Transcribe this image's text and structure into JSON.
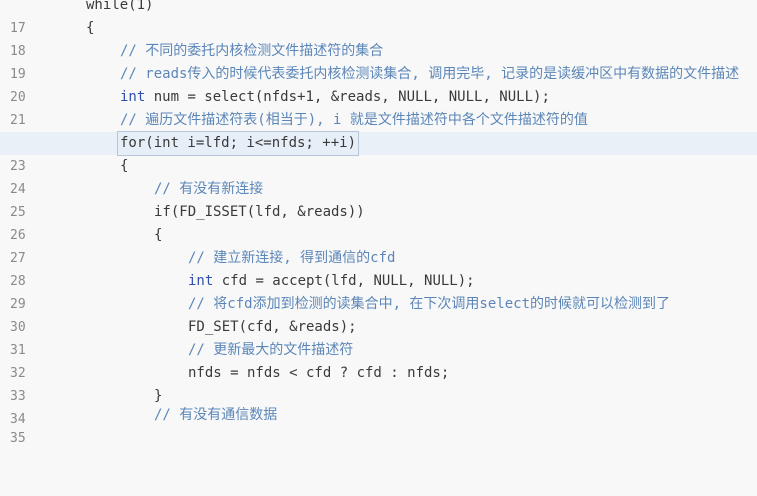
{
  "editor": {
    "lines": [
      {
        "no": "17",
        "text": "while(1)"
      },
      {
        "no": "18",
        "text": "{"
      },
      {
        "no": "19",
        "text": "// 不同的委托内核检测文件描述符的集合"
      },
      {
        "no": "20",
        "text": "// reads传入的时候代表委托内核检测读集合, 调用完毕, 记录的是读缓冲区中有数据的文件描述"
      },
      {
        "no": "21",
        "text_kw": "int",
        "text": " num = select(nfds+1, &reads, NULL, NULL, NULL);"
      },
      {
        "no": "22",
        "text": "// 遍历文件描述符表(相当于), i 就是文件描述符中各个文件描述符的值"
      },
      {
        "no": "23",
        "text": "for(int i=lfd; i<=nfds; ++i)"
      },
      {
        "no": "24",
        "text": "{"
      },
      {
        "no": "25",
        "text": "// 有没有新连接"
      },
      {
        "no": "26",
        "text": "if(FD_ISSET(lfd, &reads))"
      },
      {
        "no": "27",
        "text": "{"
      },
      {
        "no": "28",
        "text": "// 建立新连接, 得到通信的cfd"
      },
      {
        "no": "29",
        "text_kw": "int",
        "text": " cfd = accept(lfd, NULL, NULL);"
      },
      {
        "no": "30",
        "text": "// 将cfd添加到检测的读集合中, 在下次调用select的时候就可以检测到了"
      },
      {
        "no": "31",
        "text": "FD_SET(cfd, &reads);"
      },
      {
        "no": "32",
        "text": "// 更新最大的文件描述符"
      },
      {
        "no": "33",
        "text": "nfds = nfds < cfd ? cfd : nfds;"
      },
      {
        "no": "34",
        "text": "}"
      },
      {
        "no": "35",
        "text": "// 有没有通信数据"
      }
    ]
  }
}
